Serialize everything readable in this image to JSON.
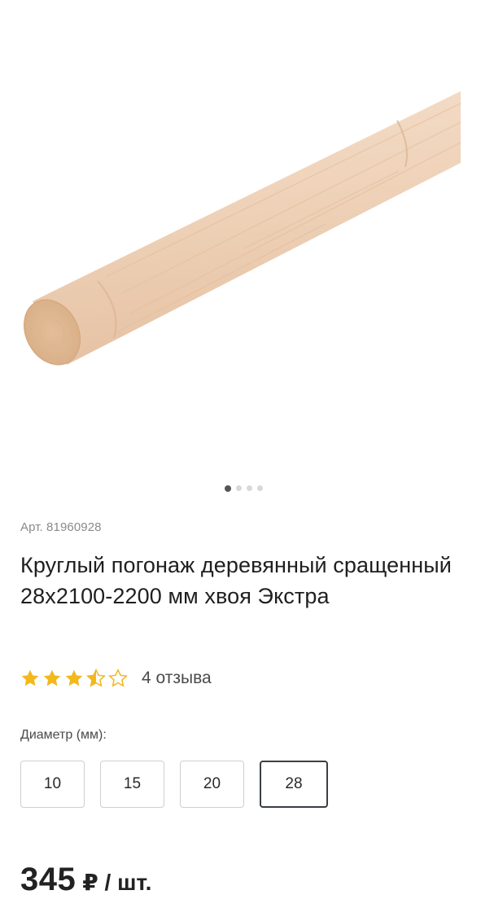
{
  "gallery": {
    "image_alt": "Круглый погонаж деревянный",
    "dots_count": 4,
    "active_dot": 0
  },
  "product": {
    "sku": "Арт. 81960928",
    "title": "Круглый погонаж деревянный сращенный 28х2100-2200 мм хвоя Экстра",
    "rating": 3.5,
    "rating_max": 5,
    "reviews": "4 отзыва"
  },
  "diameter": {
    "label": "Диаметр (мм):",
    "options": [
      "10",
      "15",
      "20",
      "28"
    ],
    "selected": "28"
  },
  "price": {
    "value": "345",
    "unit": "₽ / шт."
  },
  "colors": {
    "star": "#f2b81c",
    "star_empty": "#f2b81c",
    "selected_border": "#3a3f45"
  }
}
